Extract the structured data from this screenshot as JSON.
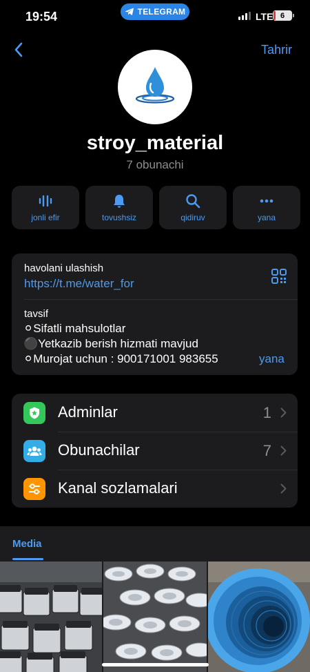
{
  "status_bar": {
    "time": "19:54",
    "app_pill": "TELEGRAM",
    "network": "LTE",
    "battery_label": "6",
    "battery_level": 0.06
  },
  "nav": {
    "edit_label": "Tahrir"
  },
  "channel": {
    "name": "stroy_material",
    "subscribers": "7 obunachi"
  },
  "actions": [
    {
      "label": "jonli efir",
      "icon": "live-stream-icon"
    },
    {
      "label": "tovushsiz",
      "icon": "bell-icon"
    },
    {
      "label": "qidiruv",
      "icon": "search-icon"
    },
    {
      "label": "yana",
      "icon": "more-icon"
    }
  ],
  "info": {
    "link_label": "havolani ulashish",
    "link": "https://t.me/water_for",
    "description_label": "tavsif",
    "description_lines": [
      "⚪Sifatli mahsulotlar",
      "⚫️Yetkazib berish hizmati mavjud",
      "⚪Murojat uchun : 900171001 983655"
    ],
    "more_label": "yana"
  },
  "menu": [
    {
      "label": "Adminlar",
      "count": "1",
      "icon": "admin-badge-icon",
      "color": "#34c759"
    },
    {
      "label": "Obunachilar",
      "count": "7",
      "icon": "people-icon",
      "color": "#32ade6"
    },
    {
      "label": "Kanal sozlamalari",
      "count": "",
      "icon": "settings-sliders-icon",
      "color": "#ff9500"
    }
  ],
  "media": {
    "tab_label": "Media"
  },
  "colors": {
    "accent": "#4c9bf0",
    "background": "#000000",
    "card": "#1c1c1e"
  }
}
